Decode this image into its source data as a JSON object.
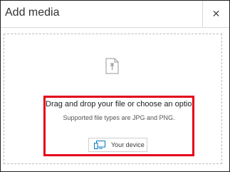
{
  "dialog": {
    "title": "Add media",
    "close_glyph": "✕"
  },
  "upload": {
    "file_icon": "upload-file-icon",
    "headline": "Drag and drop your file or choose an option",
    "subtext": "Supported file types are JPG and PNG.",
    "device_button": {
      "label": "Your device",
      "icon": "device-icon"
    }
  },
  "colors": {
    "highlight": "#e3001b",
    "accent": "#0079c1"
  }
}
